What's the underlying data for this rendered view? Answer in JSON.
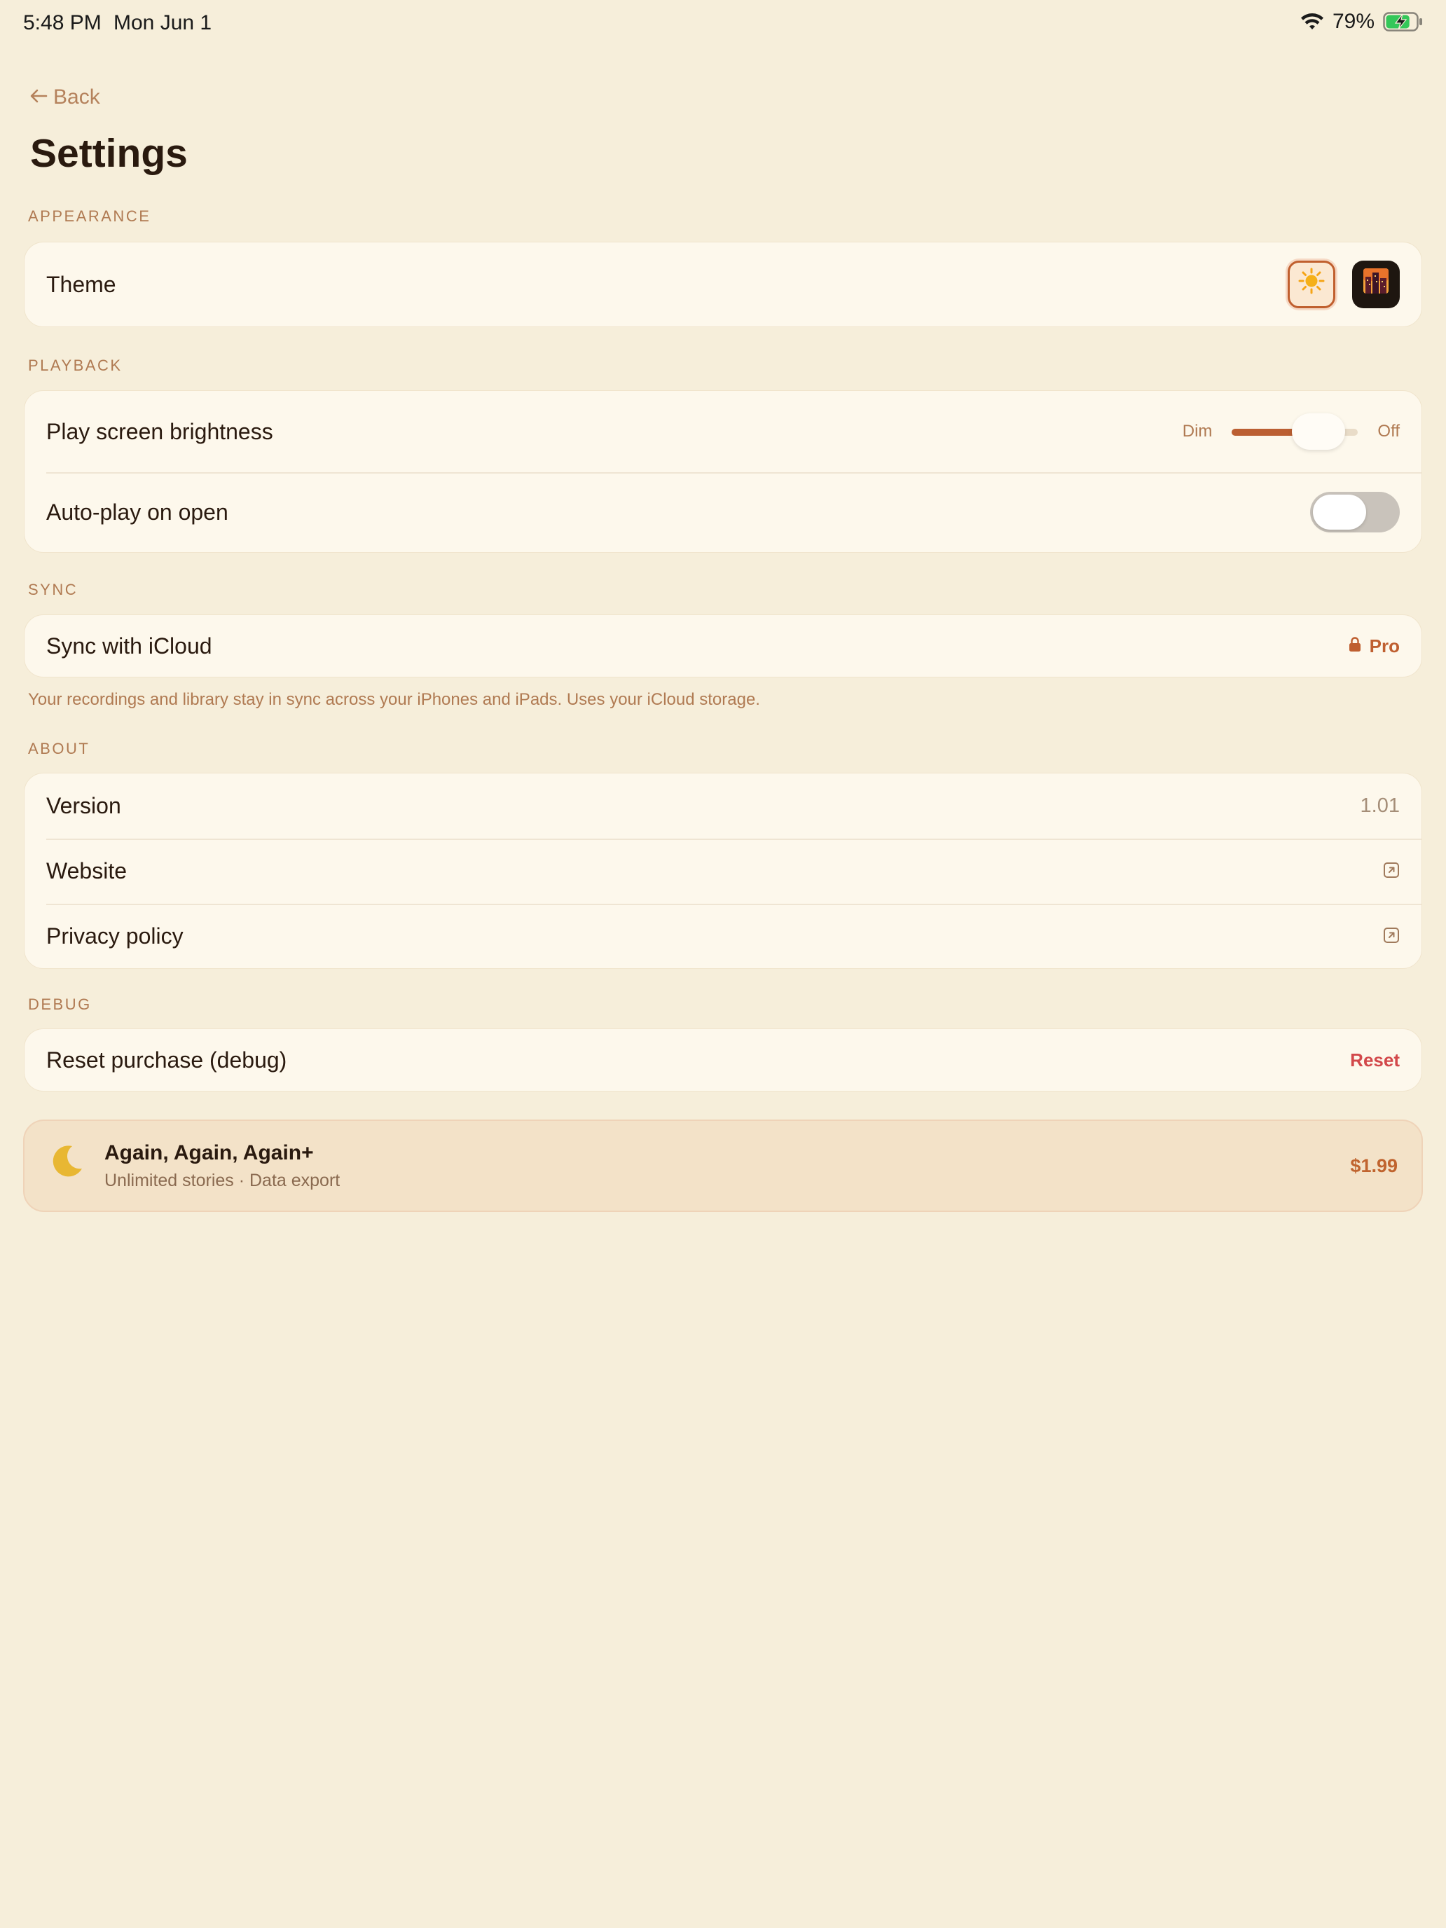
{
  "status_bar": {
    "time": "5:48 PM",
    "date": "Mon Jun 1",
    "battery_percent": "79%",
    "battery_level": 0.79
  },
  "header": {
    "back_label": "Back",
    "title": "Settings"
  },
  "sections": {
    "appearance": {
      "header": "APPEARANCE",
      "theme_label": "Theme",
      "theme_options": [
        "light-theme",
        "dark-theme"
      ],
      "selected_theme": "light-theme"
    },
    "playback": {
      "header": "PLAYBACK",
      "brightness_label": "Play screen brightness",
      "brightness_min_label": "Dim",
      "brightness_max_label": "Off",
      "brightness_value": 0.82,
      "autoplay_label": "Auto-play on open",
      "autoplay_on": false
    },
    "sync": {
      "header": "SYNC",
      "icloud_label": "Sync with iCloud",
      "pro_label": "Pro",
      "footnote": "Your recordings and library stay in sync across your iPhones and iPads. Uses your iCloud storage."
    },
    "about": {
      "header": "ABOUT",
      "version_label": "Version",
      "version_value": "1.01",
      "website_label": "Website",
      "privacy_label": "Privacy policy"
    },
    "debug": {
      "header": "DEBUG",
      "reset_label": "Reset purchase (debug)",
      "reset_action": "Reset"
    }
  },
  "promo": {
    "title": "Again, Again, Again+",
    "subtitle": "Unlimited stories · Data export",
    "price": "$1.99"
  },
  "colors": {
    "background": "#f6eeda",
    "card": "#fdf8ec",
    "accent": "#bf5f30",
    "danger": "#d2484a",
    "muted": "#b07a52"
  }
}
